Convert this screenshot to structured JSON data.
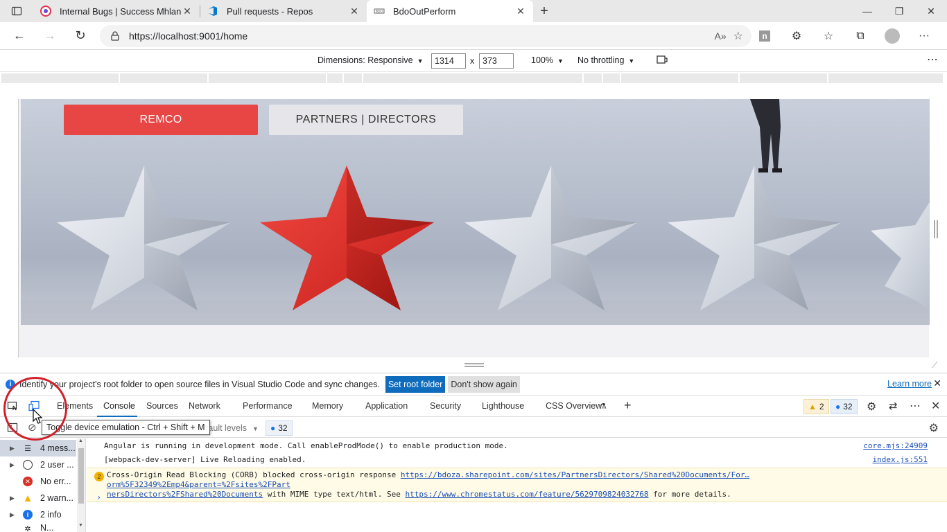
{
  "browser": {
    "tabs": [
      {
        "title": "Internal Bugs | Success Mhlanga",
        "active": false
      },
      {
        "title": "Pull requests - Repos",
        "active": false
      },
      {
        "title": "BdoOutPerform",
        "active": true
      }
    ],
    "url": "https://localhost:9001/home"
  },
  "device_toolbar": {
    "dimensions_label": "Dimensions: Responsive",
    "width": "1314",
    "height": "373",
    "times": "x",
    "zoom": "100%",
    "throttling": "No throttling"
  },
  "page": {
    "remco_button": "REMCO",
    "partners_button": "PARTNERS | DIRECTORS"
  },
  "infobar": {
    "message": "Identify your project's root folder to open source files in Visual Studio Code and sync changes.",
    "set_root": "Set root folder",
    "dont_show": "Don't show again",
    "learn_more": "Learn more"
  },
  "devtools": {
    "tabs": [
      "Elements",
      "Console",
      "Sources",
      "Network",
      "Performance",
      "Memory",
      "Application",
      "Security",
      "Lighthouse",
      "CSS Overview"
    ],
    "active_tab": "Console",
    "warnings_count": "2",
    "messages_count": "32",
    "tooltip": "Toggle device emulation - Ctrl + Shift + M",
    "levels_partial": "efault levels",
    "filter_count": "32"
  },
  "console_sidebar": [
    {
      "label": "4 mess...",
      "icon": "list-icon",
      "selected": true
    },
    {
      "label": "2 user ...",
      "icon": "user-icon",
      "selected": false
    },
    {
      "label": "No err...",
      "icon": "error-icon",
      "selected": false
    },
    {
      "label": "2 warn...",
      "icon": "warning-icon",
      "selected": false
    },
    {
      "label": "2 info",
      "icon": "info-icon",
      "selected": false
    },
    {
      "label": "N...",
      "icon": "verbose-icon",
      "selected": false
    }
  ],
  "console_logs": [
    {
      "text": "Angular is running in development mode. Call enableProdMode() to enable production mode.",
      "source": "core.mjs:24909"
    },
    {
      "text": "[webpack-dev-server] Live Reloading enabled.",
      "source": "index.js:551"
    },
    {
      "count": "2",
      "pre": "Cross-Origin Read Blocking (CORB) blocked cross-origin response ",
      "link1a": "https://bdoza.sharepoint.com/sites/PartnersDirectors/Shared%20Documents/For…orm%5F32349%2Emp4&parent=%2Fsites%2FPart",
      "link1b": "nersDirectors%2FShared%20Documents",
      "mid": " with MIME type text/html. See ",
      "link2": "https://www.chromestatus.com/feature/5629709824032768",
      "post": " for more details."
    }
  ],
  "colors": {
    "accent_red": "#e84545",
    "devtools_blue": "#0f6cbd",
    "annotation_circle": "#d0202a"
  }
}
